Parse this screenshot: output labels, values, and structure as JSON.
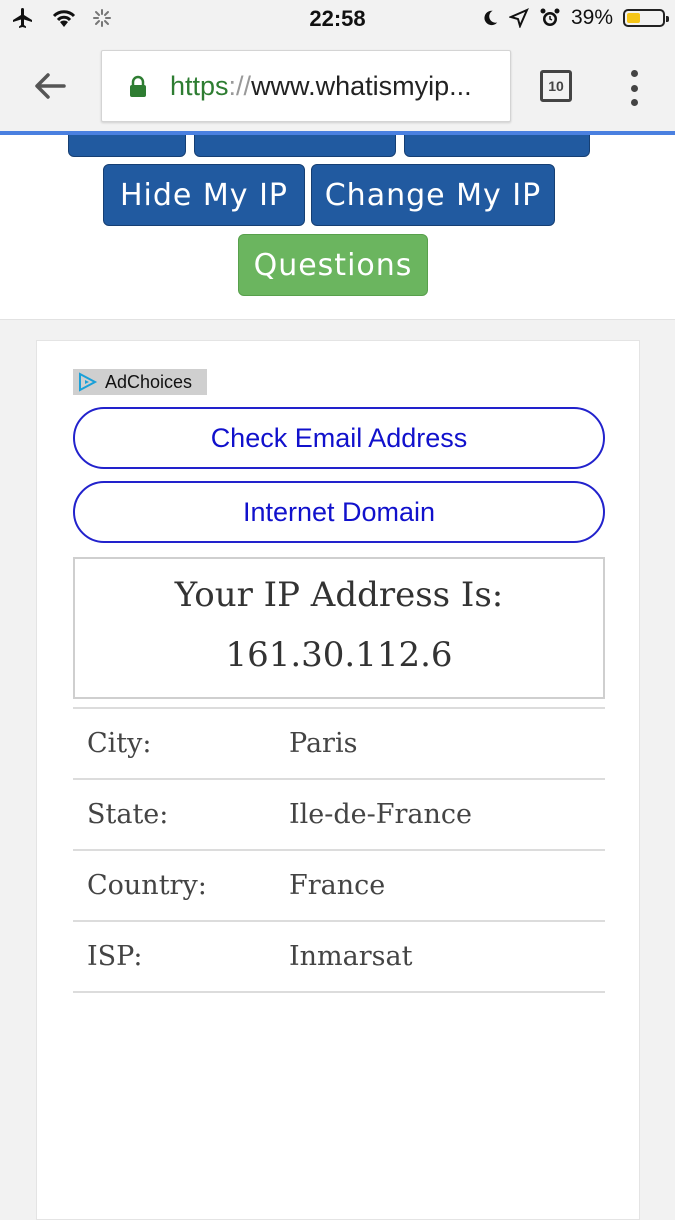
{
  "status_bar": {
    "time": "22:58",
    "battery_percent": "39%",
    "battery_level": 0.39,
    "icons_left": [
      "airplane-icon",
      "wifi-icon",
      "activity-spinner-icon"
    ],
    "icons_right": [
      "moon-icon",
      "location-arrow-icon",
      "alarm-icon",
      "battery-icon"
    ]
  },
  "browser": {
    "url_scheme": "https",
    "url_separator": "://",
    "url_rest": "www.whatismyip...",
    "tab_count": "10",
    "progress": 1.0,
    "progress_color": "#4a80e0"
  },
  "nav": {
    "buttons": [
      {
        "label": "Hide My IP",
        "color": "#215aa0"
      },
      {
        "label": "Change My IP",
        "color": "#215aa0"
      },
      {
        "label": "Questions",
        "color": "#6bb55f"
      }
    ]
  },
  "ad": {
    "adchoices_label": "AdChoices",
    "buttons": [
      "Check Email Address",
      "Internet Domain"
    ]
  },
  "ip_info": {
    "heading": "Your IP Address Is:",
    "address": "161.30.112.6",
    "rows": [
      {
        "label": "City:",
        "value": "Paris"
      },
      {
        "label": "State:",
        "value": "Ile-de-France"
      },
      {
        "label": "Country:",
        "value": "France"
      },
      {
        "label": "ISP:",
        "value": "Inmarsat"
      }
    ]
  }
}
